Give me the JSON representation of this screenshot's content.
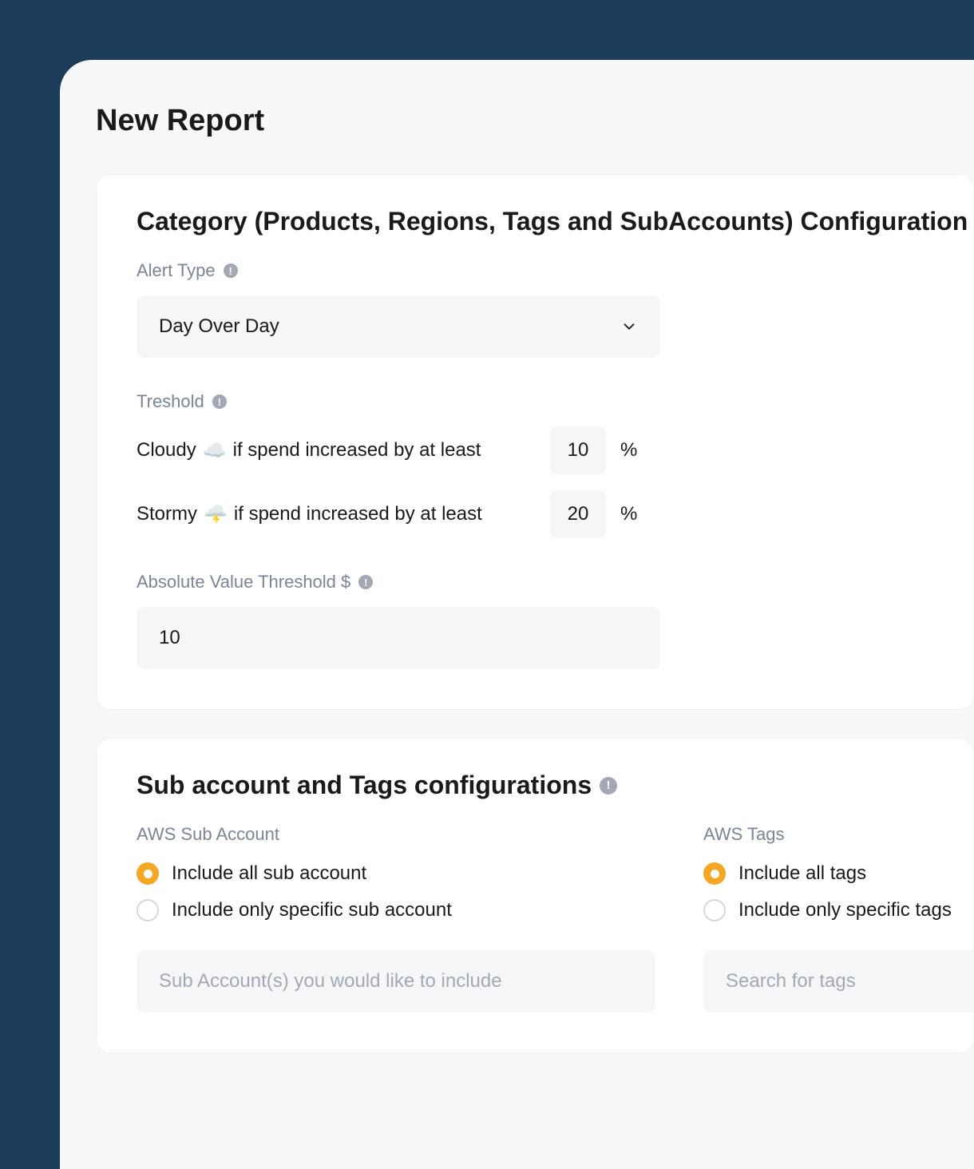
{
  "page": {
    "title": "New Report"
  },
  "card1": {
    "title": "Category (Products, Regions, Tags and SubAccounts) Configuration",
    "alertType": {
      "label": "Alert Type",
      "value": "Day Over Day"
    },
    "threshold": {
      "label": "Treshold",
      "cloudy": {
        "name": "Cloudy",
        "text": "if spend increased by at least",
        "value": "10",
        "unit": "%"
      },
      "stormy": {
        "name": "Stormy",
        "text": "if spend increased by at least",
        "value": "20",
        "unit": "%"
      }
    },
    "absoluteThreshold": {
      "label": "Absolute Value Threshold $",
      "value": "10"
    }
  },
  "card2": {
    "title": "Sub account and Tags configurations",
    "subAccount": {
      "label": "AWS Sub Account",
      "option1": "Include all sub account",
      "option2": "Include only specific sub account",
      "placeholder": "Sub Account(s) you would like to include"
    },
    "tags": {
      "label": "AWS Tags",
      "option1": "Include all tags",
      "option2": "Include only specific tags",
      "placeholder": "Search for tags"
    }
  }
}
